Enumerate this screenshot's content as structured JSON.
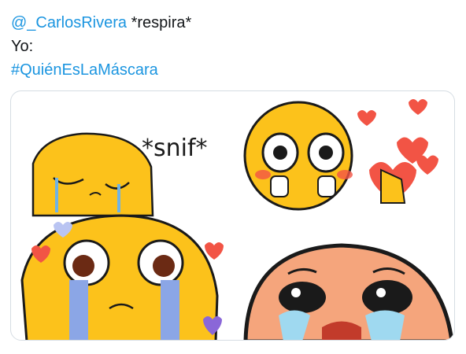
{
  "tweet": {
    "line1": {
      "mention": "@_CarlosRivera",
      "text": " *respira*"
    },
    "line2": "Yo:",
    "line3": {
      "hashtag": "#QuiénEsLaMáscara"
    }
  },
  "media": {
    "panels": [
      {
        "name": "crying-emoji-closed-eyes",
        "caption": "*snif*"
      },
      {
        "name": "pleading-emoji-with-hearts"
      },
      {
        "name": "sobbing-emoji-with-hearts"
      },
      {
        "name": "sobbing-emoji-closeup"
      }
    ],
    "colors": {
      "face": "#fcc21b",
      "tear": "#6fb3e6",
      "heart": "#f25445",
      "purple_heart": "#8a67d8"
    }
  }
}
